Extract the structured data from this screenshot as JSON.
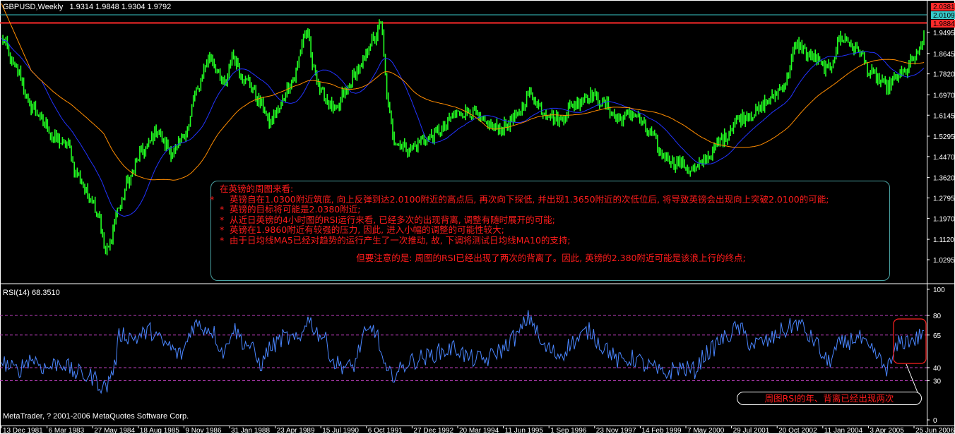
{
  "chart_data": {
    "type": "line",
    "price_panel": {
      "symbol_header": "GBPUSD,Weekly",
      "ohlc_readout": "1.9314 1.9848 1.9304 1.9792",
      "y_ticks": [
        "1.9495",
        "1.8645",
        "1.7820",
        "1.6970",
        "1.6145",
        "1.5295",
        "1.4470",
        "1.3620",
        "1.2795",
        "1.1970",
        "1.1120",
        "1.0295"
      ],
      "ylim": [
        1.0295,
        1.9495
      ],
      "price_tags": [
        {
          "label": "2.0381",
          "color": "#ff2a2a"
        },
        {
          "label": "2.0109",
          "color": "#37c9c9"
        },
        {
          "label": "1.9884",
          "color": "#ff2a2a"
        }
      ],
      "series": [
        {
          "name": "price",
          "color": "#22ff22"
        },
        {
          "name": "MA",
          "color": "#2233ff"
        },
        {
          "name": "MA",
          "color": "#ff8c00"
        }
      ],
      "anchors": [
        [
          0,
          1.92
        ],
        [
          2,
          1.8
        ],
        [
          4,
          1.65
        ],
        [
          6,
          1.58
        ],
        [
          7,
          1.52
        ],
        [
          9,
          1.49
        ],
        [
          10,
          1.38
        ],
        [
          12,
          1.28
        ],
        [
          13,
          1.22
        ],
        [
          14,
          1.06
        ],
        [
          16,
          1.25
        ],
        [
          17,
          1.35
        ],
        [
          19,
          1.47
        ],
        [
          21,
          1.55
        ],
        [
          22,
          1.5
        ],
        [
          23,
          1.46
        ],
        [
          25,
          1.55
        ],
        [
          26,
          1.7
        ],
        [
          28,
          1.85
        ],
        [
          30,
          1.74
        ],
        [
          31,
          1.85
        ],
        [
          33,
          1.75
        ],
        [
          35,
          1.66
        ],
        [
          36,
          1.58
        ],
        [
          37,
          1.63
        ],
        [
          39,
          1.75
        ],
        [
          41,
          1.95
        ],
        [
          42,
          1.8
        ],
        [
          43,
          1.7
        ],
        [
          45,
          1.63
        ],
        [
          46,
          1.7
        ],
        [
          48,
          1.8
        ],
        [
          50,
          1.92
        ],
        [
          51,
          1.98
        ],
        [
          52,
          1.65
        ],
        [
          53,
          1.5
        ],
        [
          55,
          1.48
        ],
        [
          57,
          1.52
        ],
        [
          59,
          1.55
        ],
        [
          61,
          1.62
        ],
        [
          63,
          1.63
        ],
        [
          65,
          1.58
        ],
        [
          67,
          1.56
        ],
        [
          69,
          1.6
        ],
        [
          71,
          1.7
        ],
        [
          73,
          1.63
        ],
        [
          75,
          1.6
        ],
        [
          77,
          1.66
        ],
        [
          79,
          1.7
        ],
        [
          81,
          1.66
        ],
        [
          83,
          1.6
        ],
        [
          85,
          1.62
        ],
        [
          87,
          1.55
        ],
        [
          89,
          1.45
        ],
        [
          91,
          1.42
        ],
        [
          93,
          1.39
        ],
        [
          95,
          1.45
        ],
        [
          97,
          1.52
        ],
        [
          99,
          1.6
        ],
        [
          101,
          1.62
        ],
        [
          103,
          1.67
        ],
        [
          105,
          1.73
        ],
        [
          107,
          1.9
        ],
        [
          109,
          1.85
        ],
        [
          111,
          1.8
        ],
        [
          113,
          1.93
        ],
        [
          115,
          1.88
        ],
        [
          117,
          1.78
        ],
        [
          119,
          1.73
        ],
        [
          121,
          1.78
        ],
        [
          123,
          1.85
        ],
        [
          124,
          1.92
        ]
      ]
    },
    "rsi_panel": {
      "label": "RSI(14) 68.3510",
      "y_ticks": [
        "100",
        "80",
        "65",
        "40",
        "30",
        "0"
      ],
      "ylim": [
        0,
        100
      ],
      "levels": [
        80,
        65,
        40,
        30
      ],
      "series": [
        {
          "name": "RSI(14)",
          "color": "#4a86ff"
        }
      ],
      "anchors": [
        [
          0,
          44
        ],
        [
          2,
          38
        ],
        [
          4,
          47
        ],
        [
          6,
          40
        ],
        [
          8,
          44
        ],
        [
          10,
          36
        ],
        [
          12,
          33
        ],
        [
          14,
          25
        ],
        [
          15,
          38
        ],
        [
          16,
          66
        ],
        [
          18,
          63
        ],
        [
          20,
          68
        ],
        [
          22,
          58
        ],
        [
          24,
          50
        ],
        [
          26,
          73
        ],
        [
          28,
          70
        ],
        [
          30,
          52
        ],
        [
          31,
          70
        ],
        [
          33,
          58
        ],
        [
          35,
          43
        ],
        [
          36,
          55
        ],
        [
          38,
          63
        ],
        [
          40,
          60
        ],
        [
          41,
          77
        ],
        [
          43,
          65
        ],
        [
          45,
          43
        ],
        [
          47,
          40
        ],
        [
          49,
          65
        ],
        [
          50,
          70
        ],
        [
          52,
          34
        ],
        [
          53,
          36
        ],
        [
          55,
          45
        ],
        [
          57,
          48
        ],
        [
          59,
          52
        ],
        [
          61,
          55
        ],
        [
          63,
          47
        ],
        [
          65,
          46
        ],
        [
          67,
          53
        ],
        [
          69,
          63
        ],
        [
          71,
          78
        ],
        [
          73,
          55
        ],
        [
          75,
          50
        ],
        [
          77,
          60
        ],
        [
          79,
          68
        ],
        [
          81,
          56
        ],
        [
          83,
          45
        ],
        [
          85,
          47
        ],
        [
          87,
          41
        ],
        [
          89,
          35
        ],
        [
          91,
          40
        ],
        [
          93,
          38
        ],
        [
          95,
          52
        ],
        [
          97,
          62
        ],
        [
          99,
          70
        ],
        [
          101,
          58
        ],
        [
          103,
          60
        ],
        [
          105,
          68
        ],
        [
          107,
          74
        ],
        [
          109,
          62
        ],
        [
          111,
          45
        ],
        [
          113,
          58
        ],
        [
          115,
          63
        ],
        [
          117,
          52
        ],
        [
          119,
          40
        ],
        [
          121,
          60
        ],
        [
          123,
          62
        ],
        [
          124,
          68.35
        ]
      ],
      "highlight_label": "周图RSI的年、背离已经出现两次"
    },
    "x_ticks": [
      "13 Dec 1981",
      "6 Mar 1983",
      "27 May 1984",
      "18 Aug 1985",
      "9 Nov 1986",
      "31 Jan 1988",
      "23 Apr 1989",
      "15 Jul 1990",
      "6 Oct 1991",
      "27 Dec 1992",
      "20 Mar 1994",
      "11 Jun 1995",
      "1 Sep 1996",
      "23 Nov 1997",
      "14 Feb 1999",
      "7 May 2000",
      "29 Jul 2001",
      "20 Oct 2002",
      "11 Jan 2004",
      "3 Apr 2005",
      "25 Jun 2006"
    ]
  },
  "annotation": {
    "heading": "在英镑的周图来看:",
    "bullets": [
      "英镑自在1.0300附近筑底, 向上反弹到达2.0100附近的高点后, 再次向下探低, 并出现1.3650附近的次低位后, 将导致英镑会出现向上突破2.0100的可能;",
      "英镑的目标将可能是2.0380附近;",
      "从近日英镑的4小时图的RSI运行来看, 已经多次的出现背离, 调整有随时展开的可能;",
      "英镑在1.9860附近有较强的压力, 因此, 进入小幅的调整的可能性较大;",
      "由于日均线MA5已经对趋势的运行产生了一次推动, 故, 下调将测试日均线MA10的支持;"
    ],
    "footer": "但要注意的是: 周图的RSI已经出现了两次的背离了。因此, 英镑的2.380附近可能是该浪上行的终点;"
  },
  "copyright": "MetaTrader, ? 2001-2006 MetaQuotes Software Corp."
}
